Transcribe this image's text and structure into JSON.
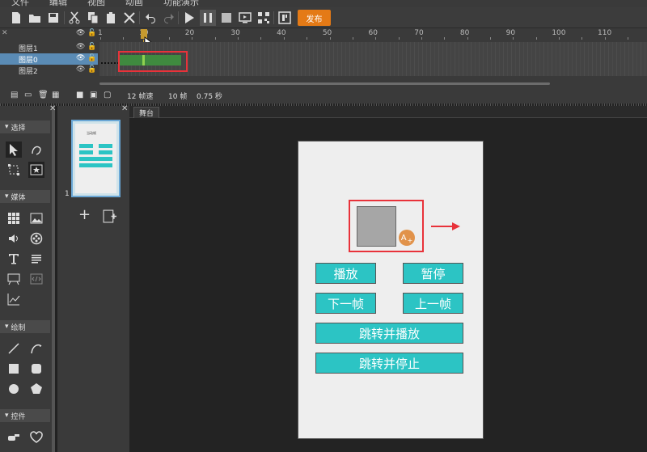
{
  "menu": [
    "文件",
    "编辑",
    "视图",
    "动画",
    "功能演示"
  ],
  "toolbar": {
    "icons": [
      "new-file-icon",
      "open-folder-icon",
      "save-icon",
      "cut-icon",
      "copy-icon",
      "paste-icon",
      "delete-icon",
      "undo-icon",
      "redo-icon",
      "play-icon",
      "pause-icon",
      "stop-icon",
      "preview-icon",
      "qr-code-icon",
      "export-icon"
    ],
    "publish_label": "发布"
  },
  "timeline": {
    "ruler_ticks": [
      "1",
      "10",
      "20",
      "30",
      "40",
      "50",
      "60",
      "70",
      "80",
      "90",
      "100",
      "110"
    ],
    "current_frame": 10,
    "layers": [
      {
        "name": "图层1",
        "selected": false
      },
      {
        "name": "图层0",
        "selected": true
      },
      {
        "name": "图层2",
        "selected": false
      }
    ],
    "fps": "12 帧速",
    "frames": "10 帧",
    "duration": "0.75 秒"
  },
  "tools": {
    "sections": [
      "选择",
      "媒体",
      "绘制",
      "控件"
    ]
  },
  "frames_panel": {
    "thumb_title": "当动帧",
    "thumb_label": "1"
  },
  "stage": {
    "tab_label": "舞台",
    "buttons": {
      "play": "播放",
      "pause": "暂停",
      "next": "下一帧",
      "prev": "上一帧",
      "goto_play": "跳转并播放",
      "goto_stop": "跳转并停止"
    },
    "highlight_color": "#e8323a",
    "button_color": "#2cc4c4",
    "badge_text": "A"
  }
}
